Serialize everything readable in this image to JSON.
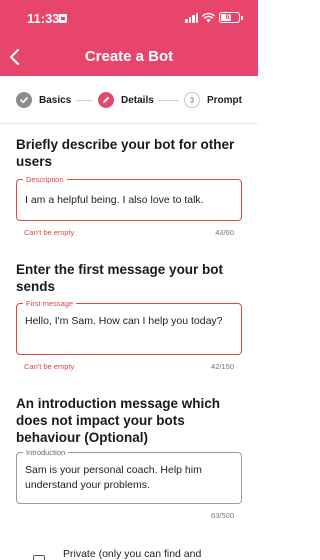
{
  "status_bar": {
    "time": "11:33",
    "battery": "61",
    "battery_fraction": 0.61
  },
  "header": {
    "title": "Create a Bot",
    "background_color": "#e8456c",
    "back_icon": "chevron-left-icon"
  },
  "stepper": {
    "steps": [
      {
        "label": "Basics",
        "state": "completed",
        "icon": "check-icon"
      },
      {
        "label": "Details",
        "state": "active",
        "icon": "pencil-icon"
      },
      {
        "number": "3",
        "label": "Prompt",
        "state": "upcoming"
      }
    ]
  },
  "sections": {
    "description": {
      "title": "Briefly describe your bot for other users",
      "field_label": "Description",
      "value": "I am a helpful being. I also love to talk.",
      "error": "Can't be empty",
      "counter": "43/60"
    },
    "first_message": {
      "title": "Enter the first message your bot sends",
      "field_label": "First message",
      "value": "Hello, I'm Sam. How can I help you today?",
      "error": "Can't be empty",
      "counter": "42/150"
    },
    "introduction": {
      "title": "An introduction message which does not impact your bots behaviour (Optional)",
      "field_label": "Introduction",
      "value": "Sam is your personal coach. Help him understand your problems.",
      "counter": "63/500"
    }
  },
  "private_option": {
    "label": "Private (only you can find and",
    "checked": false
  },
  "colors": {
    "accent": "#e8456c",
    "error": "#e04646"
  }
}
